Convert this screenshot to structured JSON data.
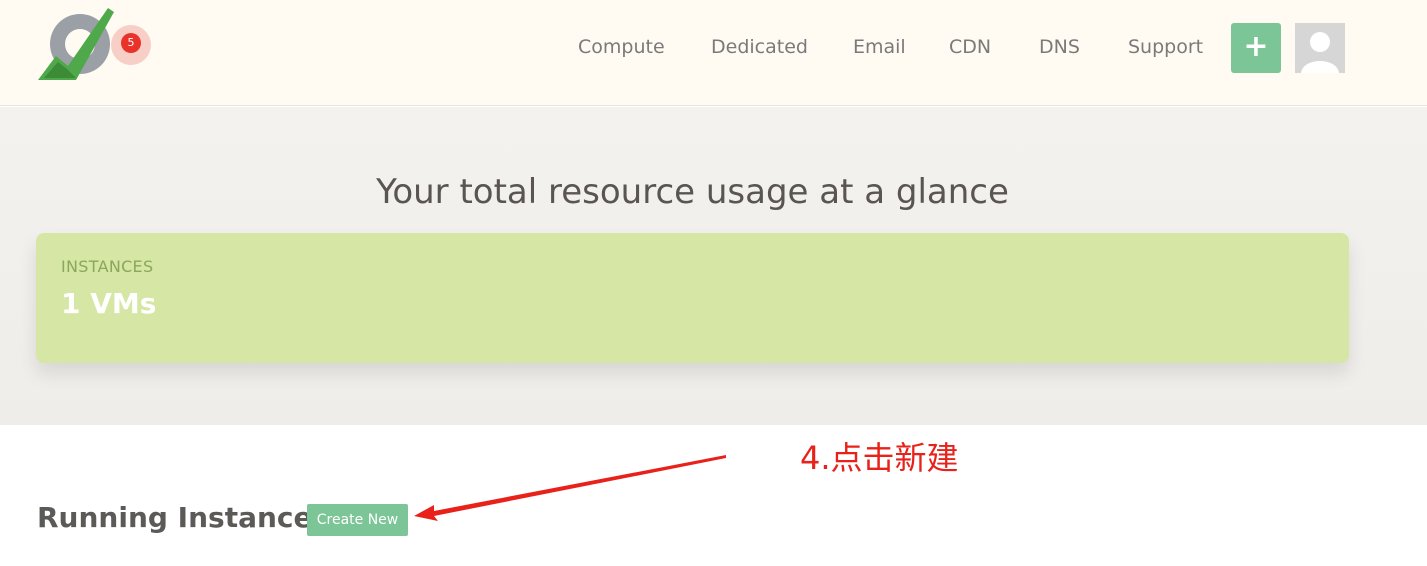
{
  "header": {
    "notification_count": "5",
    "nav": [
      "Compute",
      "Dedicated",
      "Email",
      "CDN",
      "DNS",
      "Support"
    ],
    "plus_label": "+",
    "colors": {
      "background": "#fffbf2",
      "accent": "#7cc597",
      "badge": "#e8322a"
    },
    "icons": {
      "logo": "brand-logo",
      "avatar": "user-avatar-icon"
    }
  },
  "summary": {
    "title": "Your total resource usage at a glance",
    "card": {
      "label": "INSTANCES",
      "value": "1 VMs",
      "color": "#d5e6a5"
    }
  },
  "instances": {
    "title": "Running Instances",
    "create_label": "Create New"
  },
  "annotation": {
    "text": "4.点击新建",
    "color": "#e8211b"
  }
}
